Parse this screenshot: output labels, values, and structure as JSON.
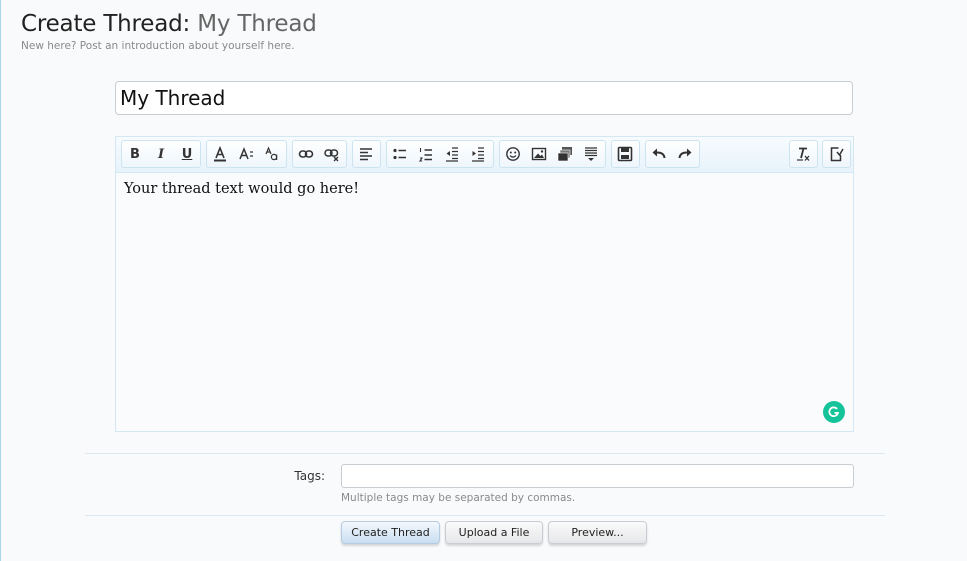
{
  "header": {
    "title_prefix": "Create Thread:",
    "title_thread": "My Thread",
    "subtitle": "New here? Post an introduction about yourself here."
  },
  "form": {
    "title_value": "My Thread",
    "editor_text": "Your thread text would go here!",
    "tags_label": "Tags:",
    "tags_value": "",
    "tags_hint": "Multiple tags may be separated by commas."
  },
  "toolbar": {
    "bold": "B",
    "italic": "I",
    "underline": "U"
  },
  "buttons": {
    "create_thread": "Create Thread",
    "upload_file": "Upload a File",
    "preview": "Preview..."
  },
  "colors": {
    "grammarly": "#15c39a",
    "primary_button": "#c9def2"
  }
}
